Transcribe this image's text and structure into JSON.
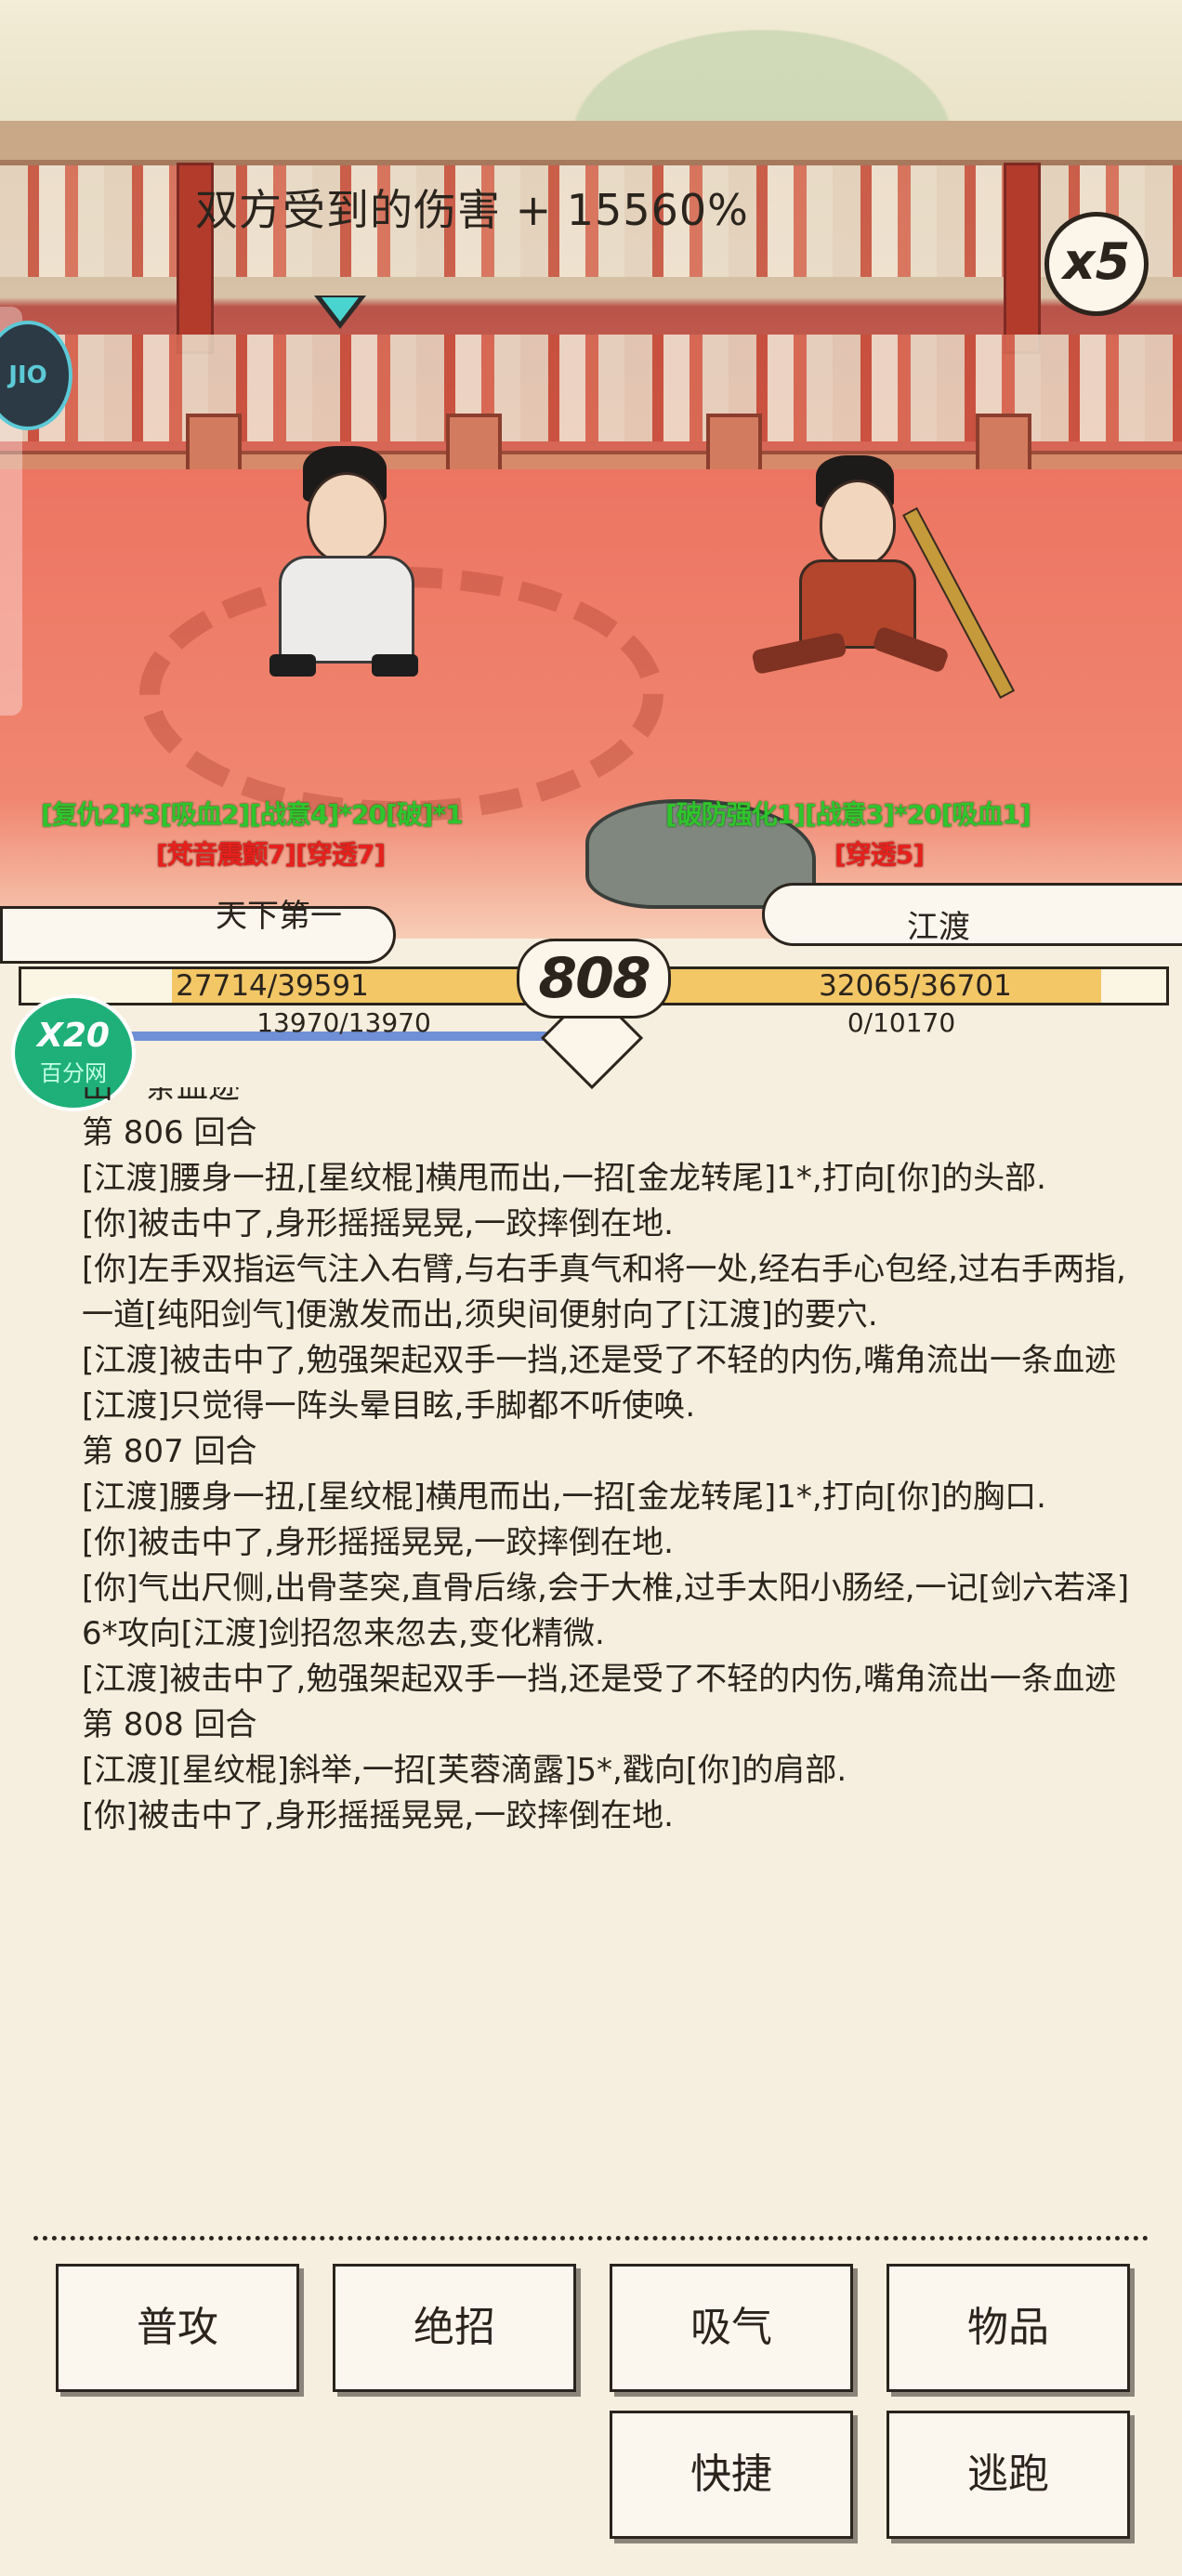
{
  "battle": {
    "damage_banner": "双方受到的伤害 + 15560%",
    "speed_multiplier": "x5",
    "round_number": "808"
  },
  "player": {
    "name": "天下第一",
    "hp_text": "27714/39591",
    "hp_fraction": 0.7,
    "mp_text": "13970/13970",
    "mp_fraction": 1.0,
    "buffs_line1": "[复仇2]*3[吸血2][战意4]*20[破]*1",
    "buffs_line2": "[梵音震颤7][穿透7]"
  },
  "enemy": {
    "name": "江渡",
    "hp_text": "32065/36701",
    "hp_fraction": 0.87,
    "mp_text": "0/10170",
    "mp_fraction": 0.0,
    "buffs_line1": "[破防强化1][战意3]*20[吸血1]",
    "buffs_line2": "[穿透5]"
  },
  "logo": {
    "line1": "X20",
    "line2": "百分网"
  },
  "side_ad": {
    "text": "JIO\nFAN"
  },
  "log": [
    "出一条血迹",
    "第 806 回合",
    "[江渡]腰身一扭,[星纹棍]横甩而出,一招[金龙转尾]1*,打向[你]的头部.",
    "[你]被击中了,身形摇摇晃晃,一跤摔倒在地.",
    "[你]左手双指运气注入右臂,与右手真气和将一处,经右手心包经,过右手两指,一道[纯阳剑气]便激发而出,须臾间便射向了[江渡]的要穴.",
    "[江渡]被击中了,勉强架起双手一挡,还是受了不轻的内伤,嘴角流出一条血迹",
    "[江渡]只觉得一阵头晕目眩,手脚都不听使唤.",
    "第 807 回合",
    "[江渡]腰身一扭,[星纹棍]横甩而出,一招[金龙转尾]1*,打向[你]的胸口.",
    "[你]被击中了,身形摇摇晃晃,一跤摔倒在地.",
    "[你]气出尺侧,出骨茎突,直骨后缘,会于大椎,过手太阳小肠经,一记[剑六若泽]6*攻向[江渡]剑招忽来忽去,变化精微.",
    "[江渡]被击中了,勉强架起双手一挡,还是受了不轻的内伤,嘴角流出一条血迹",
    "第 808 回合",
    "[江渡][星纹棍]斜举,一招[芙蓉滴露]5*,戳向[你]的肩部.",
    "[你]被击中了,身形摇摇晃晃,一跤摔倒在地."
  ],
  "actions": {
    "attack": "普攻",
    "ultimate": "绝招",
    "breathe": "吸气",
    "items": "物品",
    "quick": "快捷",
    "flee": "逃跑"
  },
  "colors": {
    "buff_good": "#2fc52c",
    "buff_bad": "#e6211c",
    "hp_fill": "#f3c766",
    "mp_fill": "#6f8fd6",
    "arena": "#ef7d6a"
  }
}
